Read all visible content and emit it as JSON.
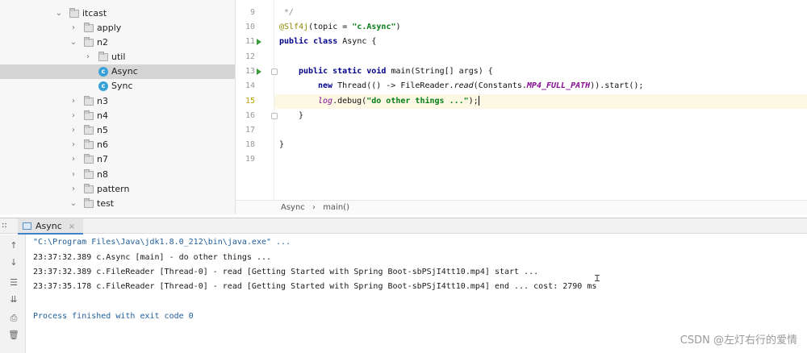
{
  "project_tree": {
    "items": [
      {
        "label": "itcast",
        "expanded": true,
        "type": "folder"
      },
      {
        "label": "apply",
        "expanded": false,
        "type": "folder"
      },
      {
        "label": "n2",
        "expanded": true,
        "type": "folder"
      },
      {
        "label": "util",
        "expanded": false,
        "type": "folder"
      },
      {
        "label": "Async",
        "type": "class",
        "selected": true
      },
      {
        "label": "Sync",
        "type": "class"
      },
      {
        "label": "n3",
        "expanded": false,
        "type": "folder"
      },
      {
        "label": "n4",
        "expanded": false,
        "type": "folder"
      },
      {
        "label": "n5",
        "expanded": false,
        "type": "folder"
      },
      {
        "label": "n6",
        "expanded": false,
        "type": "folder"
      },
      {
        "label": "n7",
        "expanded": false,
        "type": "folder"
      },
      {
        "label": "n8",
        "expanded": false,
        "type": "folder"
      },
      {
        "label": "pattern",
        "expanded": false,
        "type": "folder"
      },
      {
        "label": "test",
        "expanded": true,
        "type": "folder"
      }
    ]
  },
  "editor": {
    "line_numbers": [
      "9",
      "10",
      "11",
      "12",
      "13",
      "14",
      "15",
      "16",
      "17",
      "18",
      "19"
    ],
    "lines": [
      {
        "comment": " */"
      },
      {
        "annotation": "@Slf4j",
        "rest_a": "(topic = ",
        "string": "\"c.Async\"",
        "rest_b": ")"
      },
      {
        "kw": "public class",
        "rest": " Async {"
      },
      {},
      {
        "kw": "public static void",
        "rest": " main(String[] args) {"
      },
      {
        "kw": "new",
        "a": " Thread(() -> FileReader.",
        "italic": "read",
        "b": "(Constants.",
        "const": "MP4_FULL_PATH",
        "c": ")).start();"
      },
      {
        "log": "log",
        "a": ".debug(",
        "string": "\"do other things ...\"",
        "b": ");"
      },
      {
        "text": "}"
      },
      {},
      {
        "text": "}"
      },
      {}
    ],
    "highlighted_line": "15"
  },
  "breadcrumb": {
    "class_name": "Async",
    "separator": "›",
    "method": "main()"
  },
  "run_panel": {
    "prefix": "::",
    "tab_label": "Async",
    "tab_close": "×",
    "console_lines": [
      "\"C:\\Program Files\\Java\\jdk1.8.0_212\\bin\\java.exe\" ...",
      "23:37:32.389 c.Async [main] - do other things ...",
      "23:37:32.389 c.FileReader [Thread-0] - read [Getting Started with Spring Boot-sbPSjI4tt10.mp4] start ...",
      "23:37:35.178 c.FileReader [Thread-0] - read [Getting Started with Spring Boot-sbPSjI4tt10.mp4] end ... cost: 2790 ms",
      "",
      "Process finished with exit code 0"
    ],
    "side_icons": [
      "up-arrow-icon",
      "down-arrow-icon",
      "soft-wrap-icon",
      "scroll-to-end-icon",
      "print-icon",
      "trash-icon"
    ]
  },
  "watermark": "CSDN @左灯右行的爱情"
}
